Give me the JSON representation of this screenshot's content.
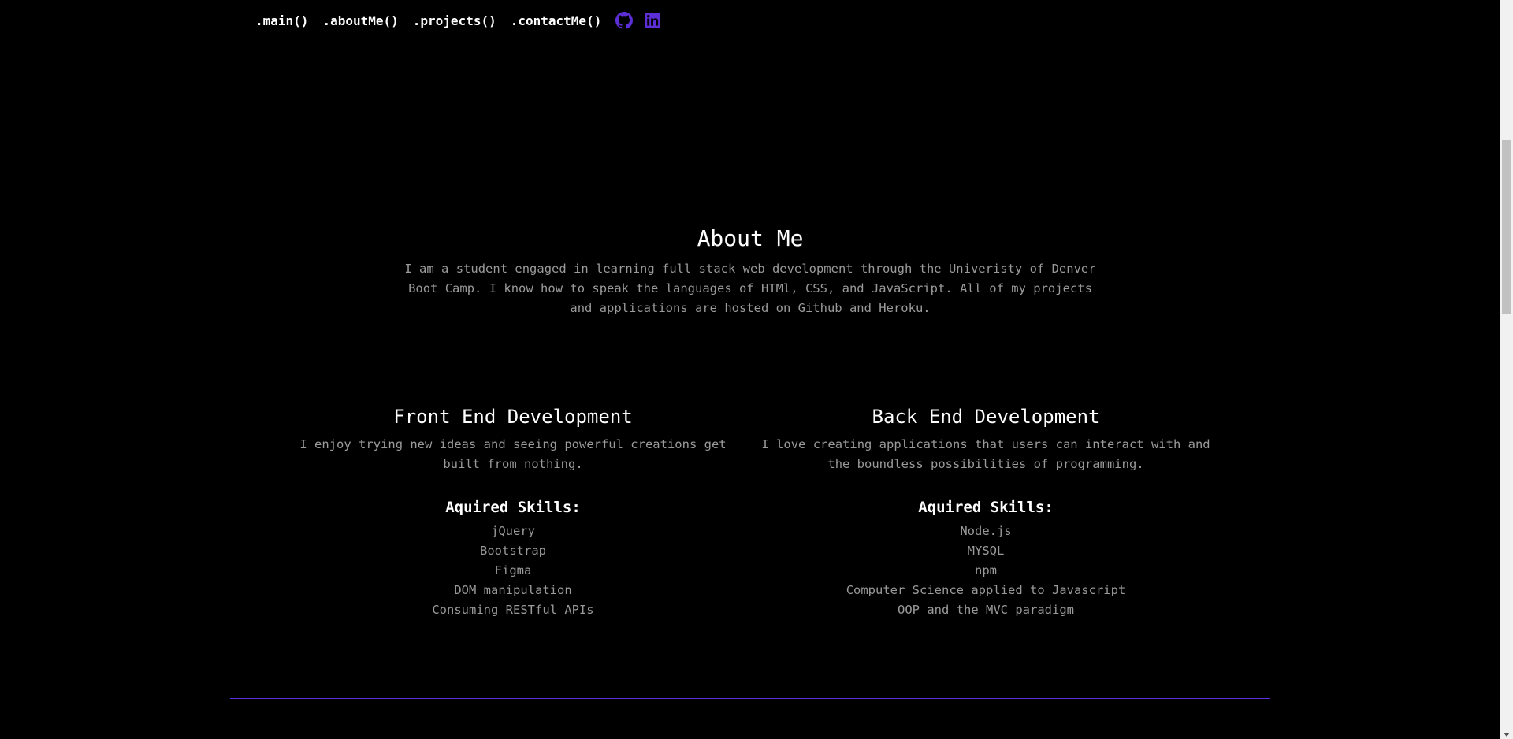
{
  "nav": {
    "links": [
      {
        "label": ".main()"
      },
      {
        "label": ".aboutMe()"
      },
      {
        "label": ".projects()"
      },
      {
        "label": ".contactMe()"
      }
    ],
    "icons": [
      "github-icon",
      "linkedin-icon"
    ],
    "icon_color": "#5b2ed6"
  },
  "about": {
    "title": "About Me",
    "text": "I am a student engaged in learning full stack web development through the Univeristy of Denver Boot Camp. I know how to speak the languages of HTMl, CSS, and JavaScript. All of my projects and applications are hosted on Github and Heroku."
  },
  "frontend": {
    "title": "Front End Development",
    "description": "I enjoy trying new ideas and seeing powerful creations get built from nothing.",
    "skills_heading": "Aquired Skills:",
    "skills": [
      "jQuery",
      "Bootstrap",
      "Figma",
      "DOM manipulation",
      "Consuming RESTful APIs"
    ]
  },
  "backend": {
    "title": "Back End Development",
    "description": "I love creating applications that users can interact with and the boundless possibilities of programming.",
    "skills_heading": "Aquired Skills:",
    "skills": [
      "Node.js",
      "MYSQL",
      "npm",
      "Computer Science applied to Javascript",
      "OOP and the MVC paradigm"
    ]
  },
  "theme": {
    "background": "#000000",
    "accent": "#5b2ed6",
    "muted_text": "#9a9a9a"
  }
}
